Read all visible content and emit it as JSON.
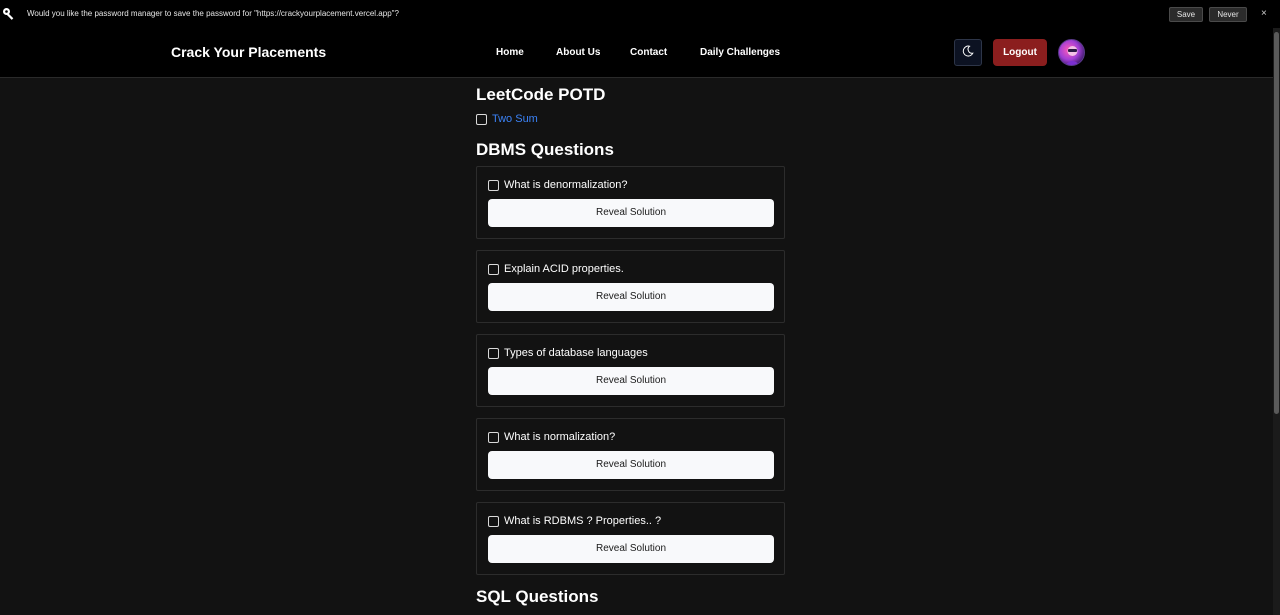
{
  "password_bar": {
    "message": "Would you like the password manager to save the password for \"https://crackyourplacement.vercel.app\"?",
    "save_label": "Save",
    "never_label": "Never",
    "close_label": "×",
    "icon": "key-icon"
  },
  "navbar": {
    "brand": "Crack Your Placements",
    "links": [
      "Home",
      "About Us",
      "Contact",
      "Daily Challenges"
    ],
    "theme_icon": "moon-icon",
    "logout_label": "Logout"
  },
  "potd": {
    "heading": "LeetCode POTD",
    "problem": "Two Sum"
  },
  "dbms": {
    "heading": "DBMS Questions",
    "questions": [
      {
        "text": "What is denormalization?",
        "button": "Reveal Solution"
      },
      {
        "text": "Explain ACID properties.",
        "button": "Reveal Solution"
      },
      {
        "text": "Types of database languages",
        "button": "Reveal Solution"
      },
      {
        "text": "What is normalization?",
        "button": "Reveal Solution"
      },
      {
        "text": "What is RDBMS ? Properties.. ?",
        "button": "Reveal Solution"
      }
    ]
  },
  "sql": {
    "heading": "SQL Questions"
  }
}
